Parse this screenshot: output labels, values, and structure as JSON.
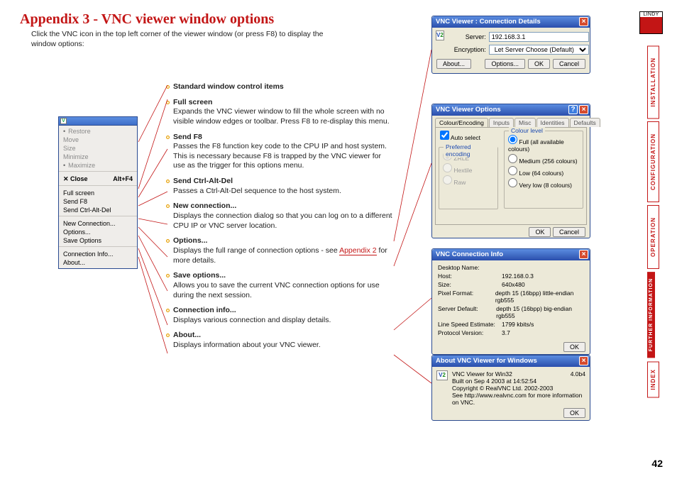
{
  "title": "Appendix 3 - VNC viewer window options",
  "intro": "Click the VNC icon in the top left corner of the viewer window (or press F8) to display the window options:",
  "page_number": "42",
  "logo_text": "LINDY",
  "sidebar": [
    {
      "label": "INSTALLATION",
      "active": false
    },
    {
      "label": "CONFIGURATION",
      "active": false
    },
    {
      "label": "OPERATION",
      "active": false
    },
    {
      "label": "FURTHER INFORMATION",
      "active": true
    },
    {
      "label": "INDEX",
      "active": false
    }
  ],
  "context_menu": {
    "restore": "Restore",
    "move": "Move",
    "size": "Size",
    "minimize": "Minimize",
    "maximize": "Maximize",
    "close": "Close",
    "close_accel": "Alt+F4",
    "full_screen": "Full screen",
    "send_f8": "Send F8",
    "send_cad": "Send Ctrl-Alt-Del",
    "new_conn": "New Connection...",
    "options": "Options...",
    "save_options": "Save Options",
    "conn_info": "Connection Info...",
    "about": "About..."
  },
  "descriptions": [
    {
      "heading": "Standard window control items",
      "body": ""
    },
    {
      "heading": "Full screen",
      "body": "Expands the VNC viewer window to fill the whole screen with no visible window edges or toolbar. Press F8 to re-display this menu."
    },
    {
      "heading": "Send F8",
      "body": "Passes the F8 function key code to the CPU IP and host system. This is necessary because F8 is trapped by the VNC viewer for use as the trigger for this options menu."
    },
    {
      "heading": "Send Ctrl-Alt-Del",
      "body": "Passes a Ctrl-Alt-Del sequence to the host system."
    },
    {
      "heading": "New connection...",
      "body": "Displays the connection dialog so that you can log on to a different CPU IP or VNC server location."
    },
    {
      "heading": "Options...",
      "body_prefix": "Displays the full range of connection options - see ",
      "link": "Appendix 2",
      "body_suffix": " for more details."
    },
    {
      "heading": "Save options...",
      "body": "Allows you to save the current VNC connection options for use during the next session."
    },
    {
      "heading": "Connection info...",
      "body": "Displays various connection and display details."
    },
    {
      "heading": "About...",
      "body": "Displays information about your VNC viewer."
    }
  ],
  "dlg_conn": {
    "title": "VNC Viewer : Connection Details",
    "server_label": "Server:",
    "server_value": "192.168.3.1",
    "enc_label": "Encryption:",
    "enc_value": "Let Server Choose (Default)",
    "btn_about": "About...",
    "btn_options": "Options...",
    "btn_ok": "OK",
    "btn_cancel": "Cancel"
  },
  "dlg_opts": {
    "title": "VNC Viewer Options",
    "tabs": [
      "Colour/Encoding",
      "Inputs",
      "Misc",
      "Identities",
      "Defaults"
    ],
    "auto_select": "Auto select",
    "enc_group": "Preferred encoding",
    "enc_opts": [
      "ZRLE",
      "Hextile",
      "Raw"
    ],
    "col_group": "Colour level",
    "col_opts": [
      "Full (all available colours)",
      "Medium (256 colours)",
      "Low (64 colours)",
      "Very low (8 colours)"
    ],
    "btn_ok": "OK",
    "btn_cancel": "Cancel"
  },
  "dlg_info": {
    "title": "VNC Connection Info",
    "rows": [
      {
        "k": "Desktop Name:",
        "v": ""
      },
      {
        "k": "Host:",
        "v": "192.168.0.3"
      },
      {
        "k": "Size:",
        "v": "640x480"
      },
      {
        "k": "Pixel Format:",
        "v": "depth 15 (16bpp) little-endian rgb555"
      },
      {
        "k": "Server Default:",
        "v": "depth 15 (16bpp) big-endian rgb555"
      },
      {
        "k": "Line Speed Estimate:",
        "v": "1799 kbits/s"
      },
      {
        "k": "Protocol Version:",
        "v": "3.7"
      }
    ],
    "btn_ok": "OK"
  },
  "dlg_about": {
    "title": "About VNC Viewer for Windows",
    "line1a": "VNC Viewer for Win32",
    "line1b": "4.0b4",
    "line2": "Built on Sep  4 2003 at 14:52:54",
    "line3": "Copyright © RealVNC Ltd. 2002-2003",
    "line4": "See http://www.realvnc.com for more information on VNC.",
    "btn_ok": "OK"
  }
}
